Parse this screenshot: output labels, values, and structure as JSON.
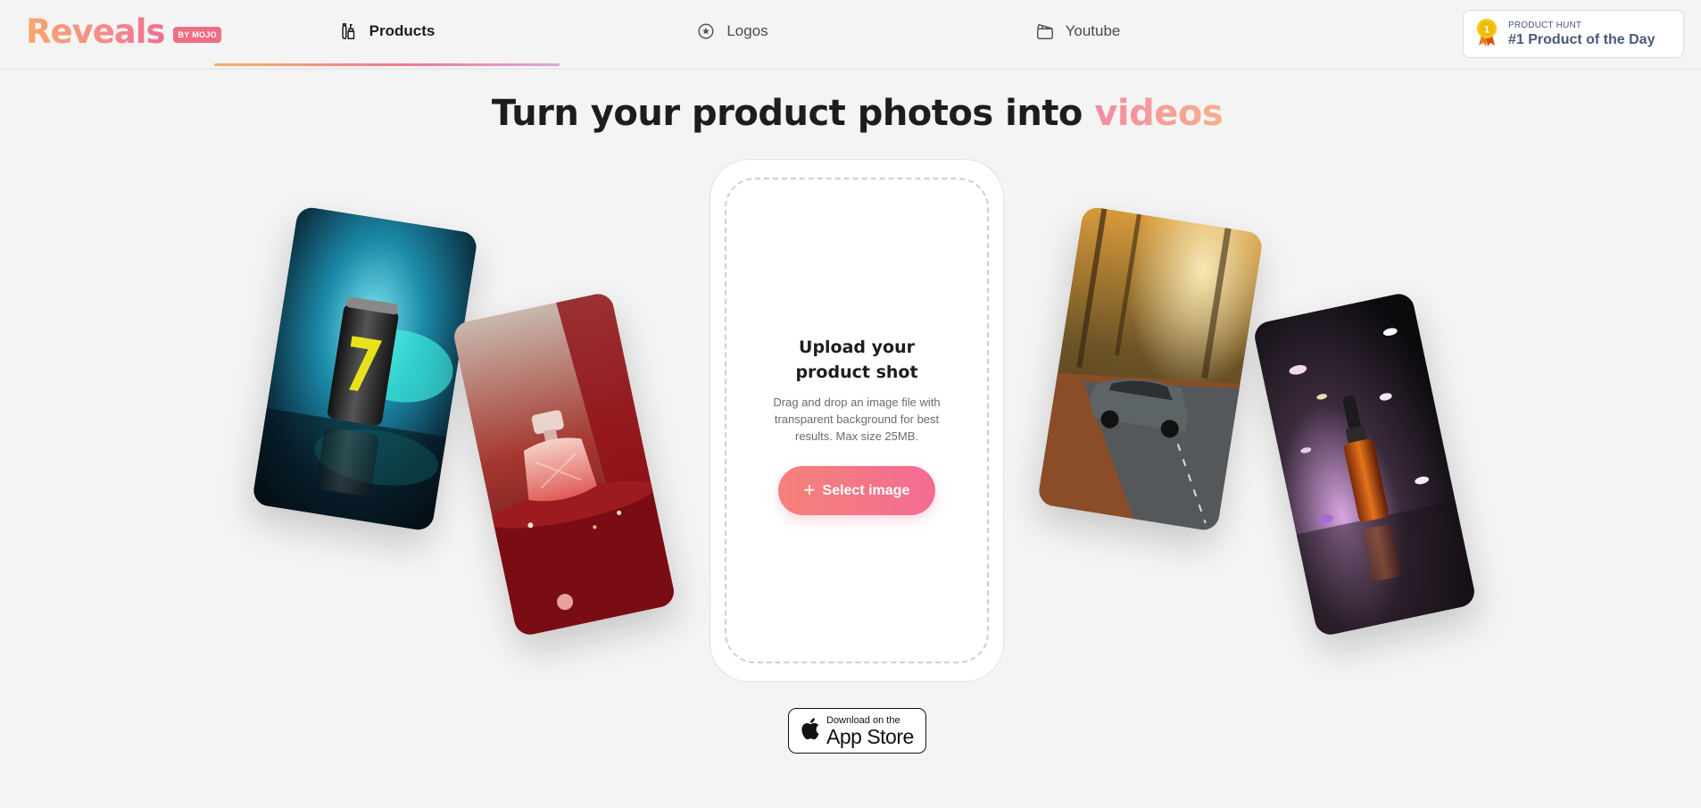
{
  "brand": {
    "name": "Reveals",
    "badge": "BY MOJO"
  },
  "nav": {
    "tabs": [
      {
        "label": "Products",
        "icon": "products-icon",
        "active": true
      },
      {
        "label": "Logos",
        "icon": "star-circle-icon",
        "active": false
      },
      {
        "label": "Youtube",
        "icon": "clapperboard-icon",
        "active": false
      }
    ]
  },
  "product_hunt": {
    "small": "PRODUCT HUNT",
    "big": "#1 Product of the Day",
    "icon": "medal-icon"
  },
  "hero": {
    "headline_main": "Turn your product photos into ",
    "headline_accent": "videos"
  },
  "upload": {
    "title": "Upload your product shot",
    "description": "Drag and drop an image file with transparent background for best results. Max size 25MB.",
    "button_label": "Select image",
    "button_icon": "plus-icon"
  },
  "app_store": {
    "small": "Download on the",
    "big": "App Store",
    "icon": "apple-icon"
  },
  "colors": {
    "accent_pink": "#f46b93",
    "accent_orange": "#f7a66b",
    "ph_text": "#4b587c",
    "background": "#f4f4f4"
  }
}
